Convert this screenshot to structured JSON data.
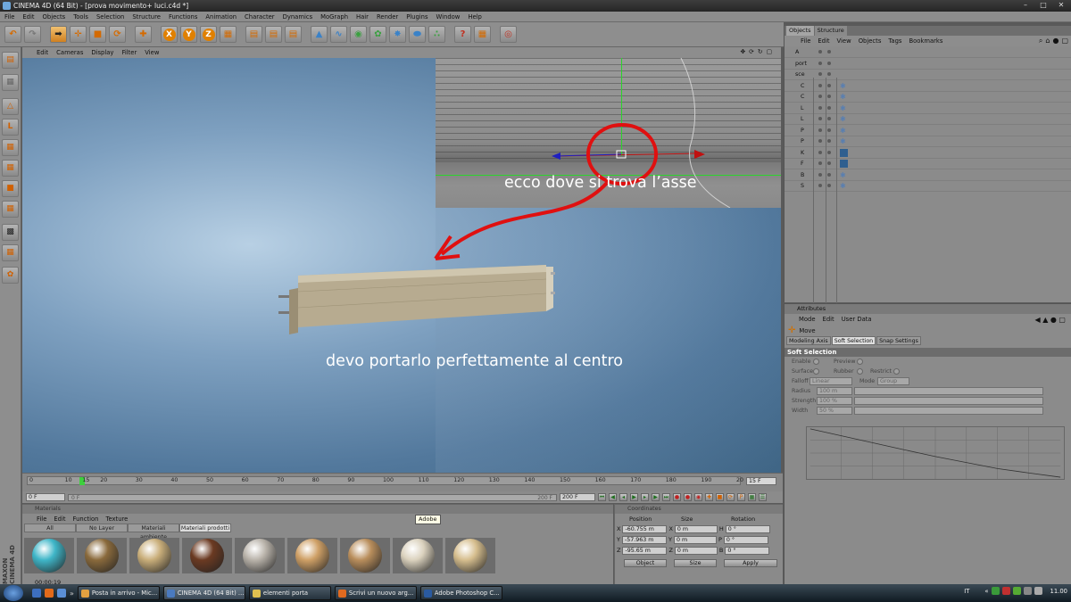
{
  "window": {
    "title": "CINEMA 4D (64 Bit) - [prova movimento+ luci.c4d *]"
  },
  "menu": [
    "File",
    "Edit",
    "Objects",
    "Tools",
    "Selection",
    "Structure",
    "Functions",
    "Animation",
    "Character",
    "Dynamics",
    "MoGraph",
    "Hair",
    "Render",
    "Plugins",
    "Window",
    "Help"
  ],
  "toolbar": {
    "axis_buttons": [
      "X",
      "Y",
      "Z"
    ],
    "icons": [
      "undo-icon",
      "redo-icon",
      "live-selection-icon",
      "move-icon",
      "scale-icon",
      "rotate-icon",
      "add-icon",
      "lock-x-icon",
      "lock-y-icon",
      "lock-z-icon",
      "coordinate-system-icon",
      "render-view-icon",
      "render-picture-viewer-icon",
      "render-settings-icon",
      "cube-icon",
      "spline-icon",
      "nurbs-icon",
      "array-icon",
      "deformer-icon",
      "scene-icon",
      "particle-icon",
      "help-icon",
      "layout-icon",
      "render-target-icon"
    ]
  },
  "viewport": {
    "menu": [
      "Edit",
      "Cameras",
      "Display",
      "Filter",
      "View"
    ],
    "annotation_1": "ecco dove si trova l’asse",
    "annotation_2": "devo portarlo perfettamente al centro"
  },
  "timeline": {
    "ticks": [
      "0",
      "10",
      "15",
      "20",
      "30",
      "40",
      "50",
      "60",
      "70",
      "80",
      "90",
      "100",
      "110",
      "120",
      "130",
      "140",
      "150",
      "160",
      "170",
      "180",
      "190",
      "20"
    ],
    "current_frame": 15,
    "max_frame": 200,
    "fps_field": "15 F",
    "start_field": "0 F",
    "end_field": "200 F",
    "min_slider": "0 F",
    "max_slider": "200 F"
  },
  "materials": {
    "panel_title": "Materials",
    "menu": [
      "File",
      "Edit",
      "Function",
      "Texture"
    ],
    "tabs": [
      "All",
      "No Layer",
      "Materiali ambiente",
      "Materiali prodotti"
    ],
    "selected_tab": "Materiali prodotti",
    "swatch_colors": [
      "#3fb6c8",
      "#8a6a3c",
      "#c9ae7a",
      "#6b3a22",
      "#b9b3aa",
      "#cfa066",
      "#b98e5c",
      "#dbd2be",
      "#d6be8e"
    ],
    "time": "00:00:19",
    "brand": "MAXON CINEMA 4D"
  },
  "tooltip": "Adobe",
  "coordinates": {
    "title": "Coordinates",
    "headers": [
      "Position",
      "Size",
      "Rotation"
    ],
    "rows": [
      {
        "axis": "X",
        "pos": "-60.755 m",
        "size_axis": "X",
        "size": "0 m",
        "rot_axis": "H",
        "rot": "0 °"
      },
      {
        "axis": "Y",
        "pos": "-57.963 m",
        "size_axis": "Y",
        "size": "0 m",
        "rot_axis": "P",
        "rot": "0 °"
      },
      {
        "axis": "Z",
        "pos": "-95.65 m",
        "size_axis": "Z",
        "size": "0 m",
        "rot_axis": "B",
        "rot": "0 °"
      }
    ],
    "mode_1": "Object",
    "mode_2": "Size",
    "apply": "Apply"
  },
  "objects": {
    "tabs": [
      "Objects",
      "Structure"
    ],
    "menu": [
      "File",
      "Edit",
      "View",
      "Objects",
      "Tags",
      "Bookmarks"
    ],
    "rows": [
      "A",
      "port",
      "sce",
      "C",
      "C",
      "L",
      "L",
      "P",
      "P",
      "K",
      "F",
      "B",
      "S"
    ]
  },
  "attributes": {
    "title": "Attributes",
    "menu": [
      "Mode",
      "Edit",
      "User Data"
    ],
    "tool": "Move",
    "tabs": [
      "Modeling Axis",
      "Soft Selection",
      "Snap Settings"
    ],
    "selected_tab": "Soft Selection",
    "section": "Soft Selection",
    "labels": {
      "enable": "Enable",
      "preview": "Preview",
      "surface": "Surface",
      "rubber": "Rubber",
      "restrict": "Restrict",
      "falloff": "Falloff",
      "falloff_val": "Linear",
      "mode": "Mode",
      "mode_val": "Group",
      "radius": "Radius",
      "radius_val": "100 m",
      "strength": "Strength",
      "strength_val": "100 %",
      "width": "Width",
      "width_val": "50 %"
    }
  },
  "taskbar": {
    "buttons": [
      "Posta in arrivo - Mic...",
      "CINEMA 4D (64 Bit) ...",
      "elementi porta",
      "Scrivi un nuovo arg...",
      "Adobe Photoshop C..."
    ],
    "active": "CINEMA 4D (64 Bit) ...",
    "lang": "IT",
    "clock": "11.00"
  }
}
